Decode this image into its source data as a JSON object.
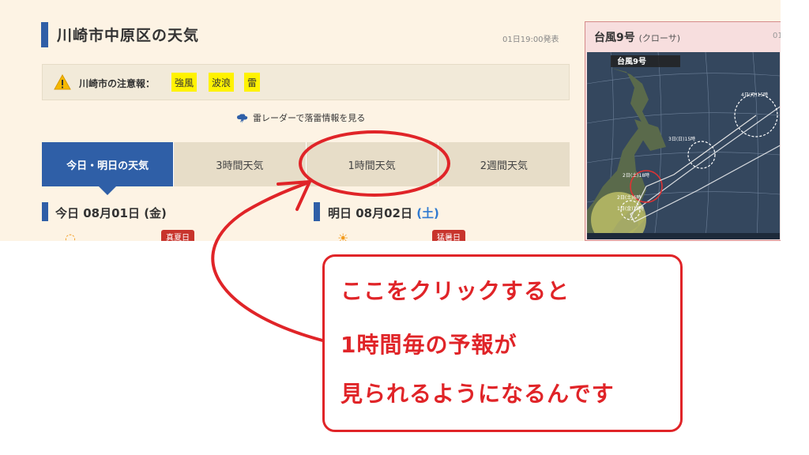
{
  "page": {
    "title": "川崎市中原区の天気",
    "issued_at": "01日19:00発表"
  },
  "alert": {
    "label": "川崎市の注意報：",
    "tags": [
      "強風",
      "波浪",
      "雷"
    ]
  },
  "radar_link": "雷レーダーで落雷情報を見る",
  "tabs": [
    {
      "label": "今日・明日の天気",
      "active": true
    },
    {
      "label": "3時間天気",
      "active": false
    },
    {
      "label": "1時間天気",
      "active": false
    },
    {
      "label": "2週間天気",
      "active": false
    }
  ],
  "today": {
    "title": "今日 08月01日 (金)",
    "badge": "真夏日"
  },
  "tomorrow": {
    "title_prefix": "明日 08月02日 ",
    "day_of_week": "(土)",
    "badge": "猛暑日"
  },
  "typhoon": {
    "title": "台風9号",
    "subtitle": "(クローサ)",
    "date_stub": "01",
    "map_label": "台風9号",
    "map_points": [
      "4日(月)15時",
      "3日(日)15時",
      "2日(土)18時",
      "2日(土)6時",
      "1日(金)18時"
    ]
  },
  "callout": {
    "lines": [
      "ここをクリックすると",
      "1時間毎の予報が",
      "見られるようになるんです"
    ]
  },
  "colors": {
    "accent_blue": "#2f5fa7",
    "annotation_red": "#e02428",
    "warning_yellow": "#fff200",
    "page_bg": "#fdf3e4"
  }
}
